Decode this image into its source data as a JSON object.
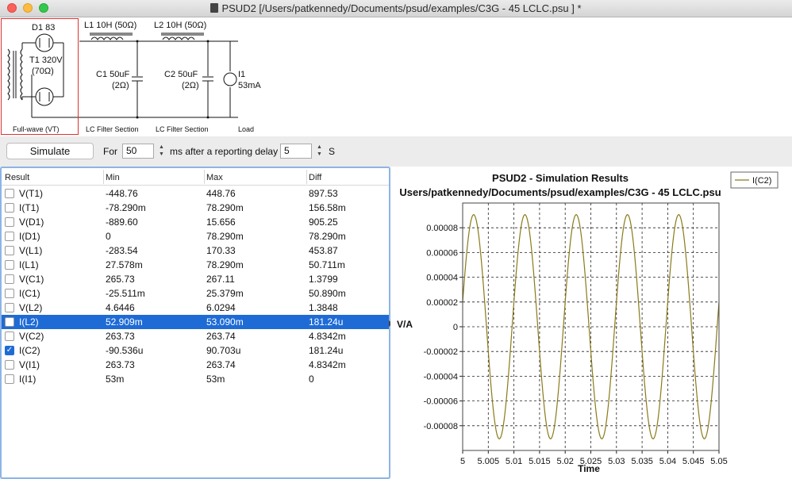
{
  "window": {
    "title": "PSUD2  [/Users/patkennedy/Documents/psud/examples/C3G - 45 LCLC.psu ] *"
  },
  "schematic": {
    "rectifier_diode": "D1 83",
    "transformer": "T1 320V",
    "transformer_res": "(70Ω)",
    "section_rectifier": "Full-wave (VT)",
    "l1": "L1 10H (50Ω)",
    "l2": "L2 10H (50Ω)",
    "c1": "C1 50uF",
    "c1_res": "(2Ω)",
    "c2": "C2 50uF",
    "c2_res": "(2Ω)",
    "i1": "I1",
    "i1_value": "53mA",
    "section_lc1": "LC Filter Section",
    "section_lc2": "LC Filter Section",
    "section_load": "Load"
  },
  "toolbar": {
    "simulate_label": "Simulate",
    "for_label": "For",
    "duration_value": "50",
    "after_label": "ms  after a reporting delay",
    "delay_value": "5",
    "unit_label": "S",
    "stepper_up": "▲",
    "stepper_down": "▼"
  },
  "table": {
    "headers": [
      "Result",
      "Min",
      "Max",
      "Diff"
    ],
    "check_glyph": "✓",
    "rows": [
      {
        "name": "V(T1)",
        "min": "-448.76",
        "max": "448.76",
        "diff": "897.53",
        "checked": false,
        "selected": false
      },
      {
        "name": "I(T1)",
        "min": "-78.290m",
        "max": "78.290m",
        "diff": "156.58m",
        "checked": false,
        "selected": false
      },
      {
        "name": "V(D1)",
        "min": "-889.60",
        "max": "15.656",
        "diff": "905.25",
        "checked": false,
        "selected": false
      },
      {
        "name": "I(D1)",
        "min": "0",
        "max": "78.290m",
        "diff": "78.290m",
        "checked": false,
        "selected": false
      },
      {
        "name": "V(L1)",
        "min": "-283.54",
        "max": "170.33",
        "diff": "453.87",
        "checked": false,
        "selected": false
      },
      {
        "name": "I(L1)",
        "min": "27.578m",
        "max": "78.290m",
        "diff": "50.711m",
        "checked": false,
        "selected": false
      },
      {
        "name": "V(C1)",
        "min": "265.73",
        "max": "267.11",
        "diff": "1.3799",
        "checked": false,
        "selected": false
      },
      {
        "name": "I(C1)",
        "min": "-25.511m",
        "max": "25.379m",
        "diff": "50.890m",
        "checked": false,
        "selected": false
      },
      {
        "name": "V(L2)",
        "min": "4.6446",
        "max": "6.0294",
        "diff": "1.3848",
        "checked": false,
        "selected": false
      },
      {
        "name": "I(L2)",
        "min": "52.909m",
        "max": "53.090m",
        "diff": "181.24u",
        "checked": false,
        "selected": true
      },
      {
        "name": "V(C2)",
        "min": "263.73",
        "max": "263.74",
        "diff": "4.8342m",
        "checked": false,
        "selected": false
      },
      {
        "name": "I(C2)",
        "min": "-90.536u",
        "max": "90.703u",
        "diff": "181.24u",
        "checked": true,
        "selected": false
      },
      {
        "name": "V(I1)",
        "min": "263.73",
        "max": "263.74",
        "diff": "4.8342m",
        "checked": false,
        "selected": false
      },
      {
        "name": "I(I1)",
        "min": "53m",
        "max": "53m",
        "diff": "0",
        "checked": false,
        "selected": false
      }
    ]
  },
  "chart_data": {
    "type": "line",
    "title": "PSUD2 - Simulation Results",
    "subtitle": "Users/patkennedy/Documents/psud/examples/C3G - 45 LCLC.psu",
    "xlabel": "Time",
    "ylabel": "V/A",
    "xlim": [
      5,
      5.05
    ],
    "ylim": [
      -0.0001,
      0.0001
    ],
    "xticks": [
      "5",
      "5.005",
      "5.01",
      "5.015",
      "5.02",
      "5.025",
      "5.03",
      "5.035",
      "5.04",
      "5.045",
      "5.05"
    ],
    "yticks": [
      "0.00008",
      "0.00006",
      "0.00004",
      "0.00002",
      "0",
      "-0.00002",
      "-0.00004",
      "-0.00006",
      "-0.00008"
    ],
    "grid": true,
    "legend_position": "top-right",
    "series": [
      {
        "name": "I(C2)",
        "color": "#8a7a1a",
        "amplitude": 9.06e-05,
        "frequency_hz": 100,
        "x": [
          5,
          5.0025,
          5.005,
          5.0075,
          5.01,
          5.0125,
          5.015,
          5.0175,
          5.02,
          5.0225,
          5.025,
          5.0275,
          5.03,
          5.0325,
          5.035,
          5.0375,
          5.04,
          5.0425,
          5.045,
          5.0475,
          5.05
        ],
        "y": [
          2e-05,
          9e-05,
          2e-05,
          -9e-05,
          2e-05,
          9e-05,
          2e-05,
          -9e-05,
          2e-05,
          9e-05,
          2e-05,
          -9e-05,
          2e-05,
          9e-05,
          2e-05,
          -9e-05,
          2e-05,
          9e-05,
          2e-05,
          -9e-05,
          2e-05
        ]
      }
    ]
  }
}
